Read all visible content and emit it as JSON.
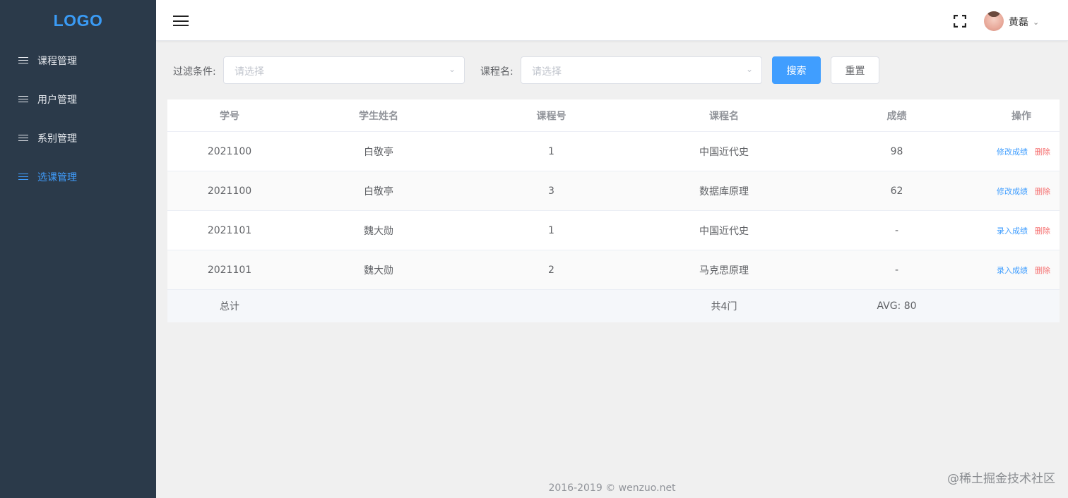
{
  "sidebar": {
    "logo": "LOGO",
    "items": [
      {
        "label": "课程管理"
      },
      {
        "label": "用户管理"
      },
      {
        "label": "系别管理"
      },
      {
        "label": "选课管理"
      }
    ],
    "active_index": 3
  },
  "header": {
    "username": "黄磊",
    "icons": [
      "hamburger-icon",
      "fullscreen-icon",
      "avatar",
      "chevron-down-icon"
    ]
  },
  "filter": {
    "label1": "过滤条件:",
    "select1_placeholder": "请选择",
    "label2": "课程名:",
    "select2_placeholder": "请选择",
    "search_button": "搜索",
    "reset_button": "重置"
  },
  "table": {
    "columns": [
      "学号",
      "学生姓名",
      "课程号",
      "课程名",
      "成绩",
      "操作"
    ],
    "rows": [
      {
        "id": "2021100",
        "name": "白敬亭",
        "course_no": "1",
        "course": "中国近代史",
        "score": "98",
        "action": "修改成绩",
        "delete": "删除"
      },
      {
        "id": "2021100",
        "name": "白敬亭",
        "course_no": "3",
        "course": "数据库原理",
        "score": "62",
        "action": "修改成绩",
        "delete": "删除"
      },
      {
        "id": "2021101",
        "name": "魏大勋",
        "course_no": "1",
        "course": "中国近代史",
        "score": "-",
        "action": "录入成绩",
        "delete": "删除"
      },
      {
        "id": "2021101",
        "name": "魏大勋",
        "course_no": "2",
        "course": "马克思原理",
        "score": "-",
        "action": "录入成绩",
        "delete": "删除"
      }
    ],
    "summary": {
      "label": "总计",
      "course": "共4门",
      "score": "AVG: 80"
    }
  },
  "footer": {
    "copyright": "2016-2019 © wenzuo.net"
  },
  "watermark": "@稀土掘金技术社区",
  "colors": {
    "sidebar_bg": "#2b3a4a",
    "accent": "#409eff",
    "danger": "#f56c6c",
    "logo": "#3a9bf5"
  }
}
